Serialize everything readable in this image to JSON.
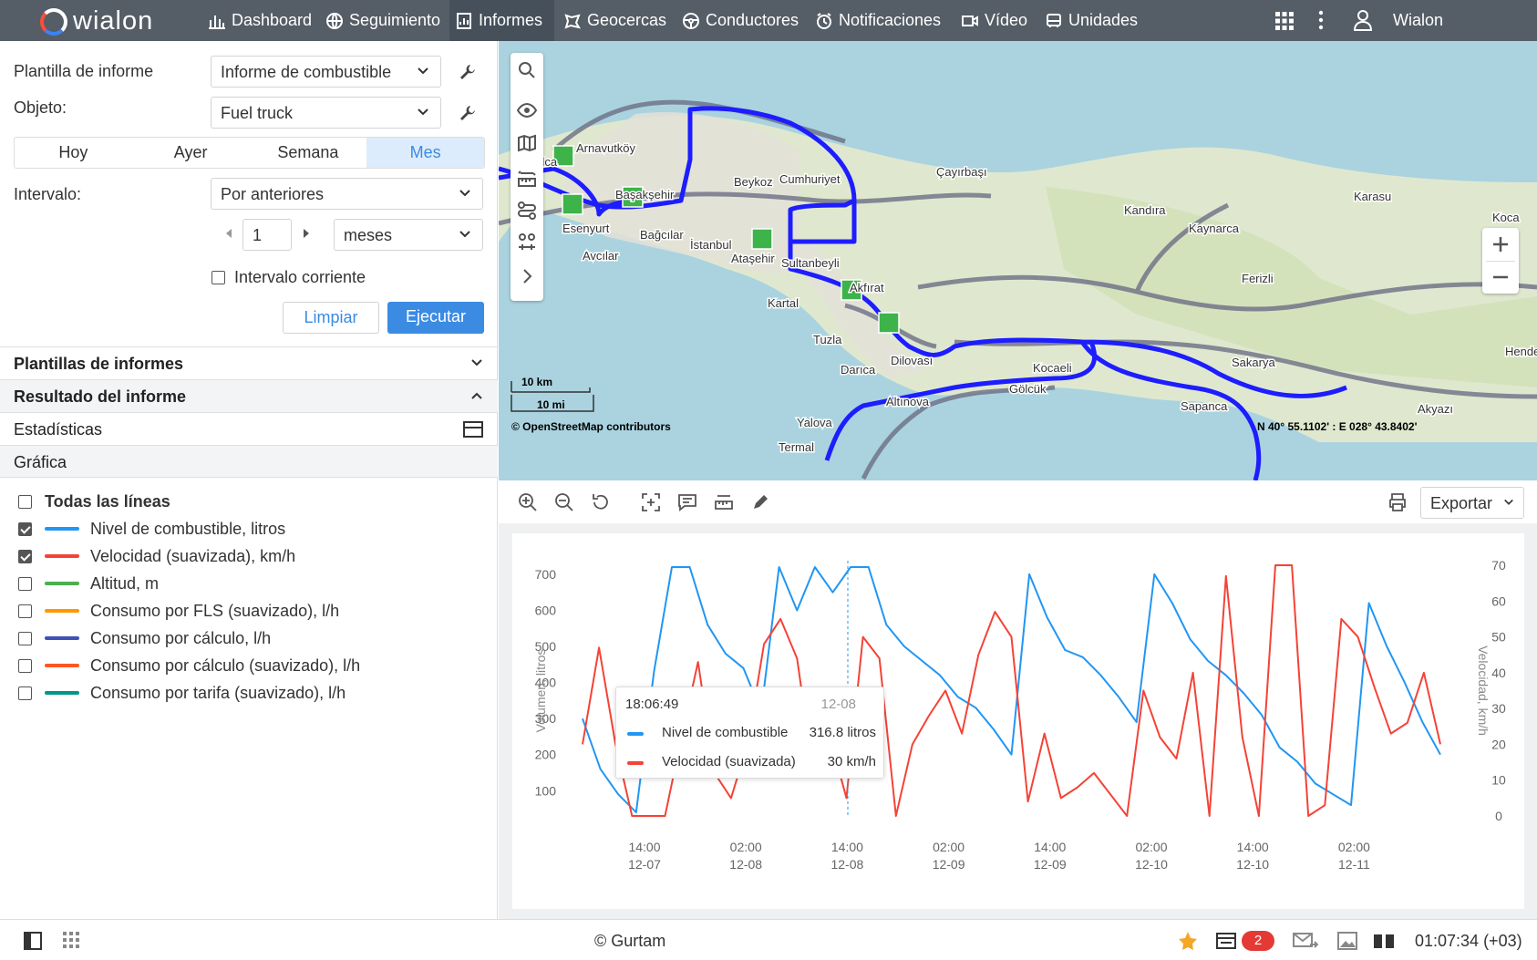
{
  "app": {
    "logo_text": "wialon",
    "user_name": "Wialon"
  },
  "nav": [
    {
      "label": "Dashboard",
      "icon": "bar-chart-icon"
    },
    {
      "label": "Seguimiento",
      "icon": "globe-icon"
    },
    {
      "label": "Informes",
      "icon": "report-icon",
      "active": true
    },
    {
      "label": "Geocercas",
      "icon": "geofence-icon"
    },
    {
      "label": "Conductores",
      "icon": "steering-wheel-icon"
    },
    {
      "label": "Notificaciones",
      "icon": "clock-alarm-icon"
    },
    {
      "label": "Vídeo",
      "icon": "video-icon"
    },
    {
      "label": "Unidades",
      "icon": "bus-icon"
    }
  ],
  "form": {
    "template_label": "Plantilla de informe",
    "template_value": "Informe de combustible",
    "object_label": "Objeto:",
    "object_value": "Fuel truck",
    "date_tabs": [
      "Hoy",
      "Ayer",
      "Semana",
      "Mes"
    ],
    "date_tab_active": "Mes",
    "interval_label": "Intervalo:",
    "interval_value": "Por anteriores",
    "interval_count": "1",
    "interval_unit": "meses",
    "current_interval_label": "Intervalo corriente",
    "clear_label": "Limpiar",
    "run_label": "Ejecutar"
  },
  "sections": {
    "templates": "Plantillas de informes",
    "result": "Resultado del informe",
    "statistics": "Estadísticas",
    "chart": "Gráfica"
  },
  "legend": {
    "all_lines": "Todas las líneas",
    "items": [
      {
        "label": "Nivel de combustible, litros",
        "color": "#2196f3",
        "checked": true
      },
      {
        "label": "Velocidad (suavizada), km/h",
        "color": "#f44336",
        "checked": true
      },
      {
        "label": "Altitud, m",
        "color": "#4caf50",
        "checked": false
      },
      {
        "label": "Consumo por FLS (suavizado), l/h",
        "color": "#ff9800",
        "checked": false
      },
      {
        "label": "Consumo por cálculo, l/h",
        "color": "#3f51b5",
        "checked": false
      },
      {
        "label": "Consumo por cálculo (suavizado), l/h",
        "color": "#ff5722",
        "checked": false
      },
      {
        "label": "Consumo por tarifa (suavizado), l/h",
        "color": "#009688",
        "checked": false
      }
    ]
  },
  "map": {
    "scale_km": "10 km",
    "scale_mi": "10 mi",
    "attribution": "© OpenStreetMap contributors",
    "coords": "N 40° 55.1102' : E 028° 43.8402'",
    "places": [
      "Çatalca",
      "Arnavutköy",
      "Başakşehir",
      "Esenyurt",
      "Bağcılar",
      "İstanbul",
      "Avcılar",
      "Beykoz",
      "Cumhuriyet",
      "Çayırbaşı",
      "Ataşehir",
      "Sultanbeyli",
      "Akfırat",
      "Kartal",
      "Tuzla",
      "Darıca",
      "Dilovası",
      "Kocaeli",
      "Gölcük",
      "Altınova",
      "Yalova",
      "Termal",
      "Kandıra",
      "Kaynarca",
      "Karasu",
      "Koca",
      "Ferizli",
      "Sakarya",
      "Hendek",
      "Sapanca",
      "Akyazı"
    ]
  },
  "toolbar": {
    "export_label": "Exportar"
  },
  "chart_data": {
    "type": "line",
    "x_ticks": [
      {
        "time": "14:00",
        "date": "12-07"
      },
      {
        "time": "02:00",
        "date": "12-08"
      },
      {
        "time": "14:00",
        "date": "12-08"
      },
      {
        "time": "02:00",
        "date": "12-09"
      },
      {
        "time": "14:00",
        "date": "12-09"
      },
      {
        "time": "02:00",
        "date": "12-10"
      },
      {
        "time": "14:00",
        "date": "12-10"
      },
      {
        "time": "02:00",
        "date": "12-11"
      }
    ],
    "ylabel_left": "Volumen, litros",
    "ylabel_right": "Velocidad, km/h",
    "y_left_ticks": [
      100,
      200,
      300,
      400,
      500,
      600,
      700
    ],
    "y_right_ticks": [
      0,
      10,
      20,
      30,
      40,
      50,
      60,
      70
    ],
    "ylim_left": [
      30,
      725
    ],
    "ylim_right": [
      0,
      70
    ],
    "series": [
      {
        "name": "Nivel de combustible",
        "axis": "left",
        "color": "#2196f3",
        "values": [
          300,
          160,
          90,
          40,
          430,
          720,
          720,
          560,
          480,
          440,
          320,
          720,
          600,
          720,
          650,
          720,
          720,
          560,
          500,
          460,
          420,
          360,
          330,
          270,
          200,
          700,
          580,
          490,
          470,
          420,
          360,
          290,
          700,
          620,
          520,
          460,
          420,
          370,
          310,
          220,
          180,
          120,
          90,
          60,
          620,
          500,
          400,
          290,
          200
        ]
      },
      {
        "name": "Velocidad (suavizada)",
        "axis": "right",
        "color": "#f44336",
        "values": [
          20,
          47,
          20,
          0,
          0,
          0,
          22,
          43,
          12,
          5,
          20,
          48,
          55,
          44,
          12,
          22,
          5,
          50,
          44,
          0,
          20,
          28,
          35,
          23,
          45,
          57,
          50,
          4,
          23,
          5,
          8,
          12,
          6,
          0,
          35,
          22,
          16,
          40,
          0,
          67,
          22,
          0,
          70,
          70,
          0,
          3,
          55,
          50,
          36,
          23,
          26,
          40,
          20
        ]
      }
    ]
  },
  "tooltip": {
    "time": "18:06:49",
    "date": "12-08",
    "rows": [
      {
        "label": "Nivel de combustible",
        "value": "316.8 litros",
        "color": "#2196f3"
      },
      {
        "label": "Velocidad (suavizada)",
        "value": "30 km/h",
        "color": "#f44336"
      }
    ]
  },
  "status": {
    "copyright": "© Gurtam",
    "notification_count": "2",
    "clock": "01:07:34 (+03)"
  }
}
